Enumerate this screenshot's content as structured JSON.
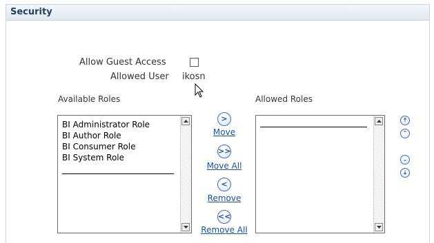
{
  "section": {
    "title": "Security"
  },
  "form": {
    "allow_guest_label": "Allow Guest Access",
    "allow_guest_checked": false,
    "allowed_user_label": "Allowed User",
    "allowed_user_value": "ikosn"
  },
  "available": {
    "label": "Available Roles",
    "items": [
      "BI Administrator Role",
      "BI Author Role",
      "BI Consumer Role",
      "BI System Role"
    ]
  },
  "allowed": {
    "label": "Allowed Roles",
    "items": []
  },
  "shuttle": {
    "move": {
      "label": "Move",
      "glyph": ">"
    },
    "move_all": {
      "label": "Move All",
      "glyph": ">>"
    },
    "remove": {
      "label": "Remove",
      "glyph": "<"
    },
    "remove_all": {
      "label": "Remove All",
      "glyph": "<<"
    }
  },
  "order_buttons": {
    "top": "⤒",
    "up": "⌃",
    "down": "⌄",
    "bottom": "⤓"
  },
  "colors": {
    "header_bg": "#dfe8f3",
    "link": "#1c4f9c",
    "title": "#23415e"
  }
}
